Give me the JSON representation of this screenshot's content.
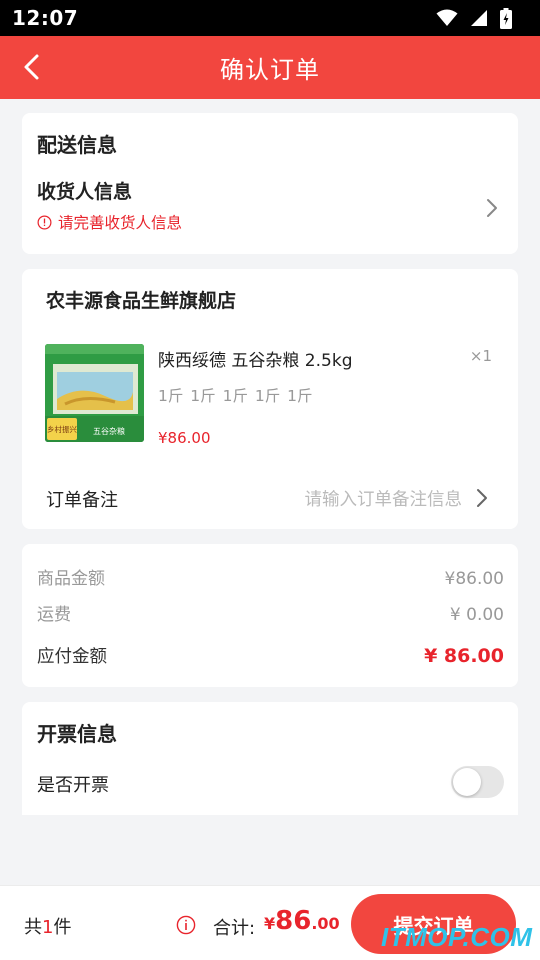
{
  "status_bar": {
    "time": "12:07"
  },
  "nav": {
    "title": "确认订单"
  },
  "delivery": {
    "title": "配送信息",
    "receiver_title": "收货人信息",
    "warning": "请完善收货人信息"
  },
  "store": {
    "name": "农丰源食品生鲜旗舰店",
    "product": {
      "name": "陕西绥德 五谷杂粮 2.5kg",
      "quantity": "×1",
      "spec": "1斤 1斤 1斤 1斤 1斤",
      "price": "¥86.00",
      "image_text": {
        "badge": "乡村振兴",
        "label": "五谷杂粮"
      }
    },
    "remark": {
      "label": "订单备注",
      "placeholder": "请输入订单备注信息"
    }
  },
  "amounts": {
    "goods_label": "商品金额",
    "goods_value": "¥86.00",
    "shipping_label": "运费",
    "shipping_value": "¥ 0.00",
    "payable_label": "应付金额",
    "payable_value": "¥ 86.00"
  },
  "invoice": {
    "title": "开票信息",
    "label": "是否开票",
    "enabled": false
  },
  "bottom": {
    "count_prefix": "共",
    "count_num": "1",
    "count_suffix": "件",
    "total_label": "合计:",
    "total_symbol": "¥",
    "total_int": "86",
    "total_dec": ".00",
    "submit_label": "提交订单"
  },
  "watermark": "ITMOP.COM",
  "colors": {
    "accent": "#f2463f",
    "price": "#e8242c",
    "watermark": "#2fc2e8"
  }
}
